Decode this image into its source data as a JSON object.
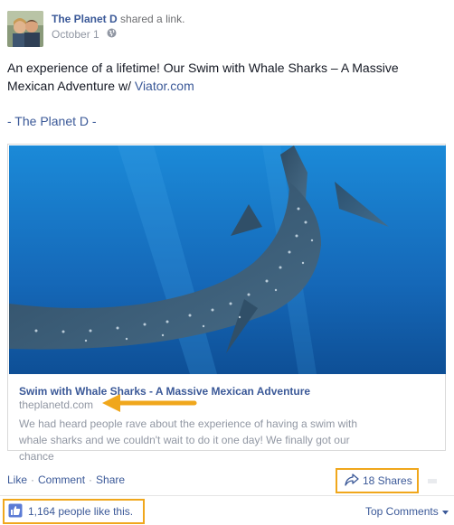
{
  "post": {
    "author": "The Planet D",
    "action": "shared a link.",
    "date": "October 1",
    "text": "An experience of a lifetime! Our Swim with Whale Sharks – A Massive Mexican Adventure w/ ",
    "text_link": "Viator.com",
    "signature": "- The Planet D -"
  },
  "link_card": {
    "title": "Swim with Whale Sharks - A Massive Mexican Adventure",
    "domain": "theplanetd.com",
    "description": "We had heard people rave about the experience of having a swim with whale sharks and we couldn't wait to do it one day! We finally got our chance"
  },
  "actions": {
    "like": "Like",
    "sep": "·",
    "comment": "Comment",
    "share": "Share",
    "shares_count": "18 Shares"
  },
  "likes_summary": "1,164 people like this.",
  "top_comments": "Top Comments",
  "colors": {
    "link": "#3b5998",
    "muted": "#9197a3",
    "highlight": "#f0a71c",
    "ocean": "#1f7fc6"
  },
  "icons": [
    "globe-icon",
    "share-arrow-icon",
    "thumbs-up-icon",
    "caret-down-icon",
    "arrow-annotation-icon"
  ]
}
